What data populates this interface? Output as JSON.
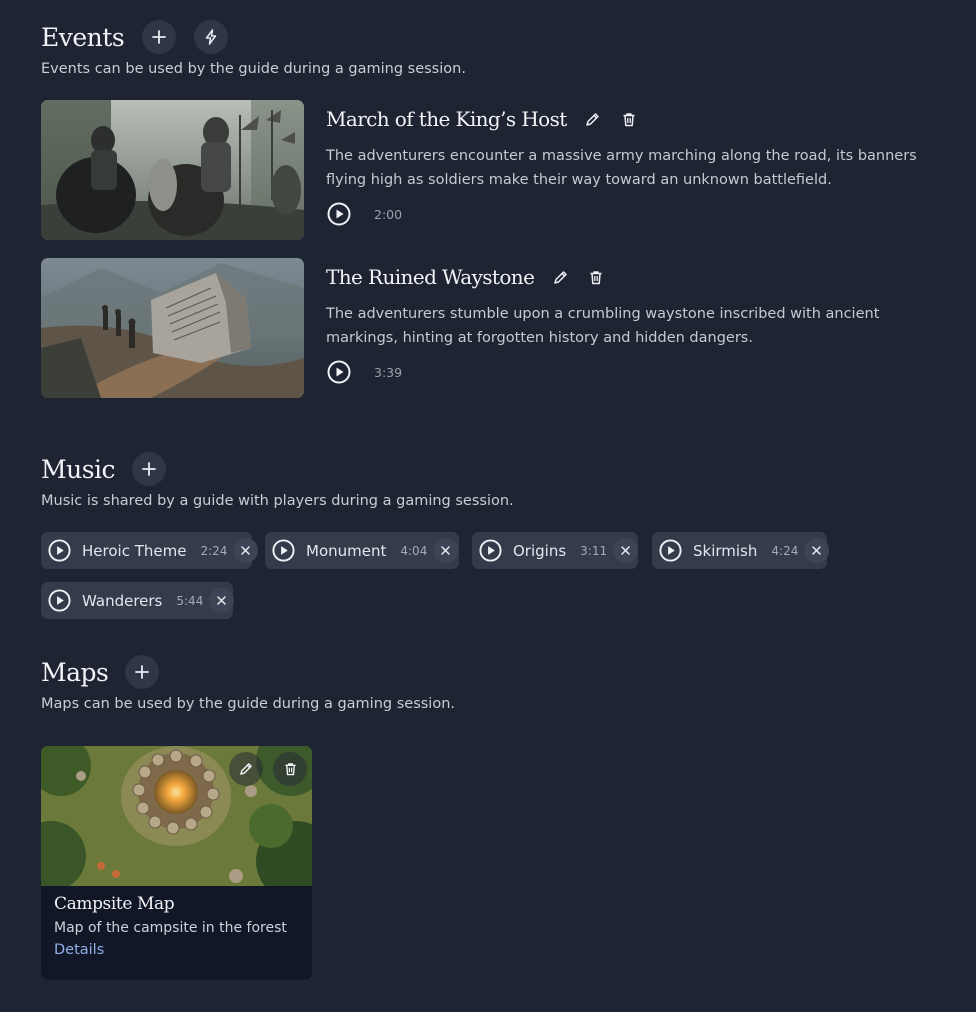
{
  "events": {
    "title": "Events",
    "description": "Events can be used by the guide during a gaming session.",
    "add_icon": "plus-icon",
    "quick_icon": "lightning-icon",
    "items": [
      {
        "title": "March of the King’s Host",
        "description": "The adventurers encounter a massive army marching along the road, its banners flying high as soldiers make their way toward an unknown battlefield.",
        "duration": "2:00"
      },
      {
        "title": "The Ruined Waystone",
        "description": "The adventurers stumble upon a crumbling waystone inscribed with ancient markings, hinting at forgotten history and hidden dangers.",
        "duration": "3:39"
      }
    ]
  },
  "music": {
    "title": "Music",
    "description": "Music is shared by a guide with players during a gaming session.",
    "tracks": [
      {
        "name": "Heroic Theme",
        "duration": "2:24"
      },
      {
        "name": "Monument",
        "duration": "4:04"
      },
      {
        "name": "Origins",
        "duration": "3:11"
      },
      {
        "name": "Skirmish",
        "duration": "4:24"
      },
      {
        "name": "Wanderers",
        "duration": "5:44"
      }
    ]
  },
  "maps": {
    "title": "Maps",
    "description": "Maps can be used by the guide during a gaming session.",
    "items": [
      {
        "title": "Campsite Map",
        "description": "Map of the campsite in the forest",
        "link": "Details"
      }
    ]
  },
  "colors": {
    "background": "#1e2432",
    "chip": "#343b4b",
    "link": "#8fb0ea"
  }
}
